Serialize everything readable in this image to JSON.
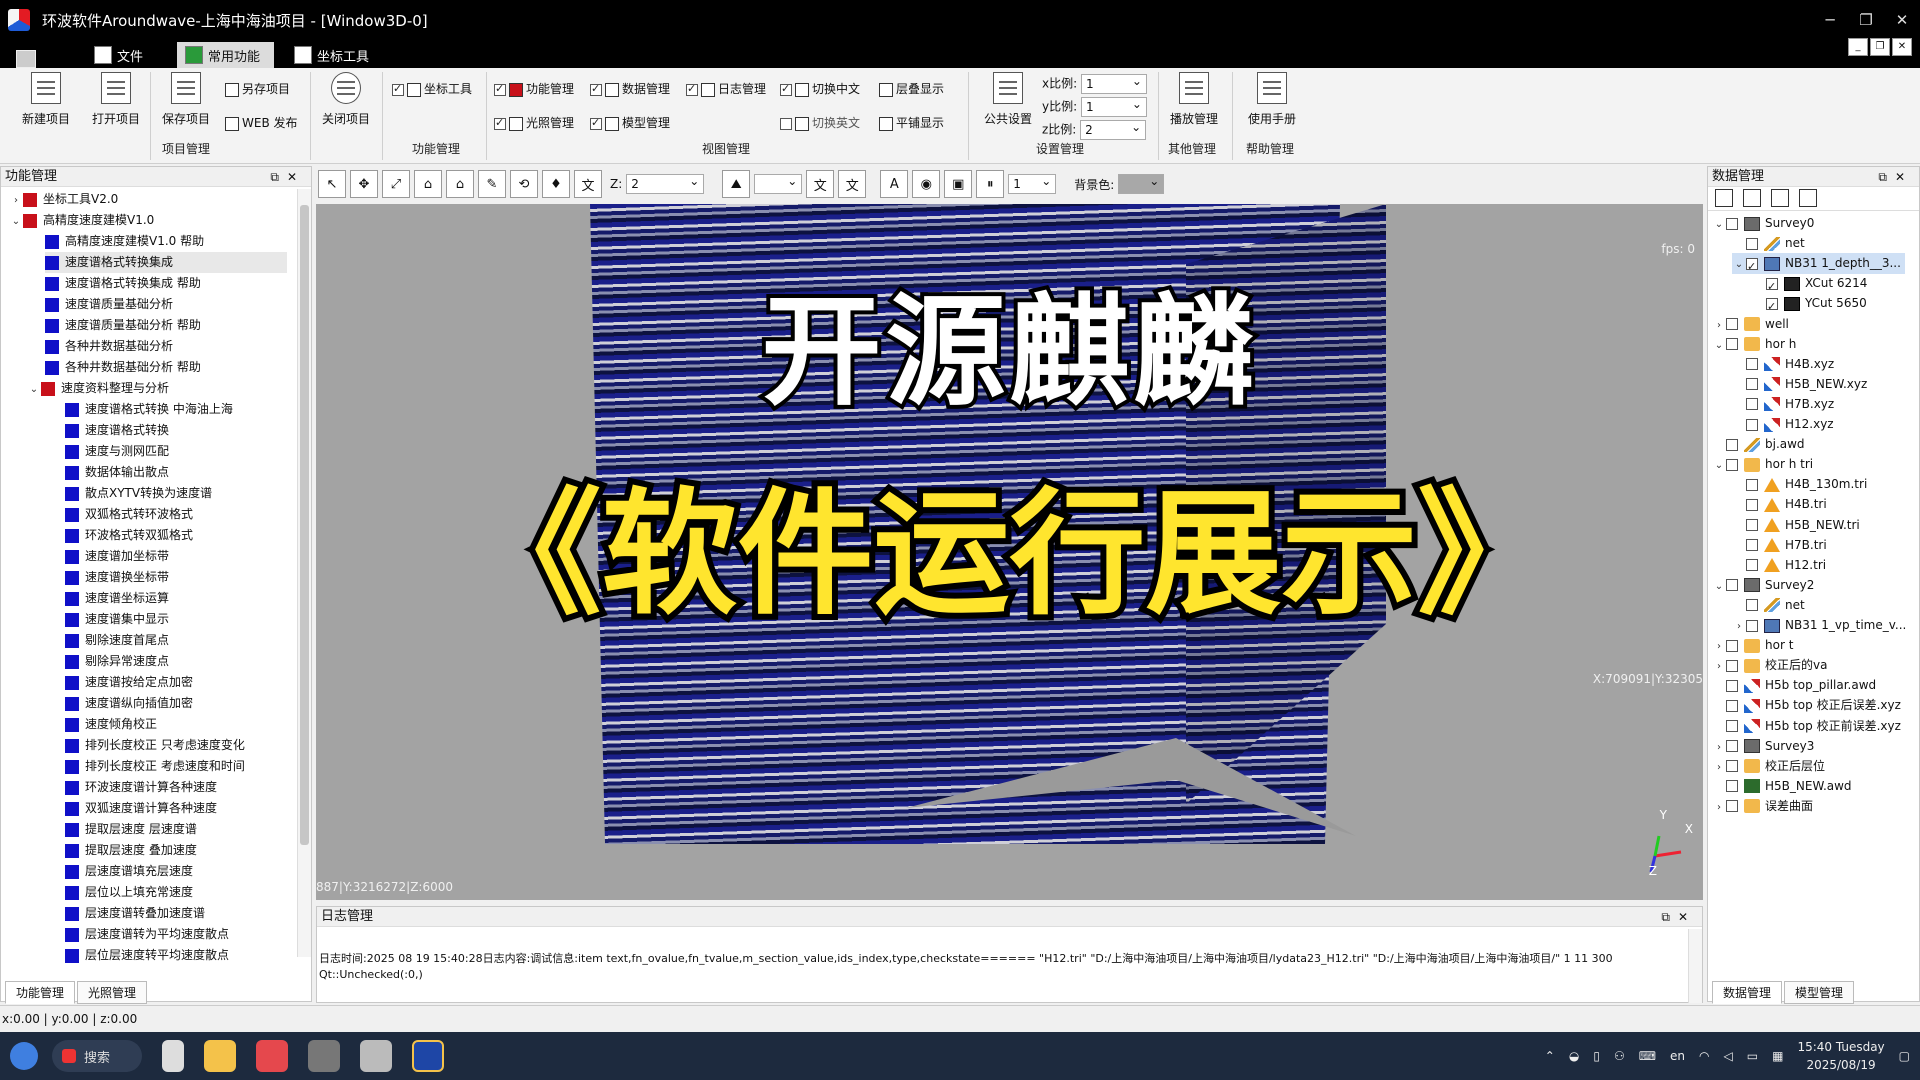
{
  "window": {
    "title": "环波软件Aroundwave-上海中海油项目 - [Window3D-0]",
    "controls": [
      "─",
      "❐",
      "✕"
    ]
  },
  "menu": {
    "tabs": [
      "文件",
      "常用功能",
      "坐标工具"
    ],
    "active_index": 1
  },
  "ribbon": {
    "project": {
      "new": "新建项目",
      "open": "打开项目",
      "save": "保存项目",
      "save_as": "另存项目",
      "web_publish": "WEB 发布",
      "close": "关闭项目",
      "group_label": "项目管理"
    },
    "function_group": {
      "coord_tool": "坐标工具",
      "group_label": "功能管理"
    },
    "view_group": {
      "func_mgmt": "功能管理",
      "data_mgmt": "数据管理",
      "log_mgmt": "日志管理",
      "light_mgmt": "光照管理",
      "model_mgmt": "模型管理",
      "switch_cn": "切换中文",
      "switch_en": "切换英文",
      "stack_display": "层叠显示",
      "tile_display": "平铺显示",
      "group_label": "视图管理"
    },
    "settings_group": {
      "public_settings": "公共设置",
      "x_scale_label": "x比例:",
      "x_scale": "1",
      "y_scale_label": "y比例:",
      "y_scale": "1",
      "z_scale_label": "z比例:",
      "z_scale": "2",
      "group_label": "设置管理"
    },
    "other_group": {
      "play": "播放管理",
      "group_label": "其他管理"
    },
    "help_group": {
      "manual": "使用手册",
      "group_label": "帮助管理"
    }
  },
  "left_panel": {
    "title": "功能管理",
    "items": [
      "坐标工具V2.0",
      "高精度速度建模V1.0",
      "高精度速度建模V1.0 帮助",
      "速度谱格式转换集成",
      "速度谱格式转换集成 帮助",
      "速度谱质量基础分析",
      "速度谱质量基础分析 帮助",
      "各种井数据基础分析",
      "各种井数据基础分析 帮助",
      "速度资料整理与分析",
      "速度谱格式转换 中海油上海",
      "速度谱格式转换",
      "速度与测网匹配",
      "数据体输出散点",
      "散点XYTV转换为速度谱",
      "双狐格式转环波格式",
      "环波格式转双狐格式",
      "速度谱加坐标带",
      "速度谱换坐标带",
      "速度谱坐标运算",
      "速度谱集中显示",
      "剔除速度首尾点",
      "剔除异常速度点",
      "速度谱按给定点加密",
      "速度谱纵向插值加密",
      "速度倾角校正",
      "排列长度校正 只考虑速度变化",
      "排列长度校正 考虑速度和时间",
      "环波速度谱计算各种速度",
      "双狐速度谱计算各种速度",
      "提取层速度 层速度谱",
      "提取层速度 叠加速度",
      "层速度谱填充层速度",
      "层位以上填充常速度",
      "层速度谱转叠加速度谱",
      "层速度谱转为平均速度散点",
      "层位层速度转平均速度散点"
    ],
    "tabs": [
      "功能管理",
      "光照管理"
    ]
  },
  "viewport_toolbar": {
    "z_label": "Z:",
    "z_value": "2",
    "num_value": "1",
    "bg_label": "背景色:"
  },
  "viewport": {
    "fps": "fps: 0",
    "headline": "开源麒麟",
    "subheadline": "《软件运行展示》",
    "coord_right": "X:709091|Y:32305",
    "coord_bottom": "887|Y:3216272|Z:6000",
    "axis_x": "X",
    "axis_y": "Y",
    "axis_z": "Z"
  },
  "log_panel": {
    "title": "日志管理",
    "text": "日志时间:2025 08 19 15:40:28日志内容:调试信息:item text,fn_ovalue,fn_tvalue,m_section_value,ids_index,type,checkstate====== \"H12.tri\" \"D:/上海中海油项目/上海中海油项目/lydata23_H12.tri\" \"D:/上海中海油项目/上海中海油项目/\" 1 11 300 Qt::Unchecked(:0,)"
  },
  "right_panel": {
    "title": "数据管理",
    "items": [
      {
        "label": "Survey0",
        "icon": "survey-icon",
        "level": 0,
        "expanded": "open",
        "checked": false
      },
      {
        "label": "net",
        "icon": "net-icon",
        "level": 1,
        "expanded": "",
        "checked": false
      },
      {
        "label": "NB31 1_depth__3...",
        "icon": "cube-icon",
        "level": 1,
        "expanded": "open",
        "checked": true,
        "selected": true
      },
      {
        "label": "XCut 6214",
        "icon": "slice-icon",
        "level": 2,
        "expanded": "",
        "checked": true
      },
      {
        "label": "YCut 5650",
        "icon": "slice-icon",
        "level": 2,
        "expanded": "",
        "checked": true
      },
      {
        "label": "well",
        "icon": "folder-icon",
        "level": 0,
        "expanded": "closed",
        "checked": false
      },
      {
        "label": "hor h",
        "icon": "folder-icon",
        "level": 0,
        "expanded": "open",
        "checked": false
      },
      {
        "label": "H4B.xyz",
        "icon": "horizon-icon",
        "level": 1,
        "expanded": "",
        "checked": false
      },
      {
        "label": "H5B_NEW.xyz",
        "icon": "horizon-icon",
        "level": 1,
        "expanded": "",
        "checked": false
      },
      {
        "label": "H7B.xyz",
        "icon": "horizon-icon",
        "level": 1,
        "expanded": "",
        "checked": false
      },
      {
        "label": "H12.xyz",
        "icon": "horizon-icon",
        "level": 1,
        "expanded": "",
        "checked": false
      },
      {
        "label": "bj.awd",
        "icon": "net-icon",
        "level": 0,
        "expanded": "",
        "checked": false
      },
      {
        "label": "hor h tri",
        "icon": "folder-icon",
        "level": 0,
        "expanded": "open",
        "checked": false
      },
      {
        "label": "H4B_130m.tri",
        "icon": "triangle-icon",
        "level": 1,
        "expanded": "",
        "checked": false
      },
      {
        "label": "H4B.tri",
        "icon": "triangle-icon",
        "level": 1,
        "expanded": "",
        "checked": false
      },
      {
        "label": "H5B_NEW.tri",
        "icon": "triangle-icon",
        "level": 1,
        "expanded": "",
        "checked": false
      },
      {
        "label": "H7B.tri",
        "icon": "triangle-icon",
        "level": 1,
        "expanded": "",
        "checked": false
      },
      {
        "label": "H12.tri",
        "icon": "triangle-icon",
        "level": 1,
        "expanded": "",
        "checked": false
      },
      {
        "label": "Survey2",
        "icon": "survey-icon",
        "level": 0,
        "expanded": "open",
        "checked": false
      },
      {
        "label": "net",
        "icon": "net-icon",
        "level": 1,
        "expanded": "",
        "checked": false
      },
      {
        "label": "NB31 1_vp_time_v...",
        "icon": "cube-icon",
        "level": 1,
        "expanded": "closed",
        "checked": false
      },
      {
        "label": "hor t",
        "icon": "folder-icon",
        "level": 0,
        "expanded": "closed",
        "checked": false
      },
      {
        "label": "校正后的va",
        "icon": "folder-icon",
        "level": 0,
        "expanded": "closed",
        "checked": false
      },
      {
        "label": "H5b top_pillar.awd",
        "icon": "horizon-icon",
        "level": 0,
        "expanded": "",
        "checked": false
      },
      {
        "label": "H5b top 校正后误差.xyz",
        "icon": "horizon-icon",
        "level": 0,
        "expanded": "",
        "checked": false
      },
      {
        "label": "H5b top 校正前误差.xyz",
        "icon": "horizon-icon",
        "level": 0,
        "expanded": "",
        "checked": false
      },
      {
        "label": "Survey3",
        "icon": "survey-icon",
        "level": 0,
        "expanded": "closed",
        "checked": false
      },
      {
        "label": "校正后层位",
        "icon": "folder-icon",
        "level": 0,
        "expanded": "closed",
        "checked": false
      },
      {
        "label": "H5B_NEW.awd",
        "icon": "well-icon",
        "level": 0,
        "expanded": "",
        "checked": false
      },
      {
        "label": "误差曲面",
        "icon": "folder-icon",
        "level": 0,
        "expanded": "closed",
        "checked": false
      }
    ],
    "tabs": [
      "数据管理",
      "模型管理"
    ]
  },
  "status_bar": {
    "text": "x:0.00 | y:0.00 | z:0.00"
  },
  "taskbar": {
    "search": "搜索",
    "lang": "en",
    "time": "15:40 Tuesday",
    "date": "2025/08/19"
  }
}
